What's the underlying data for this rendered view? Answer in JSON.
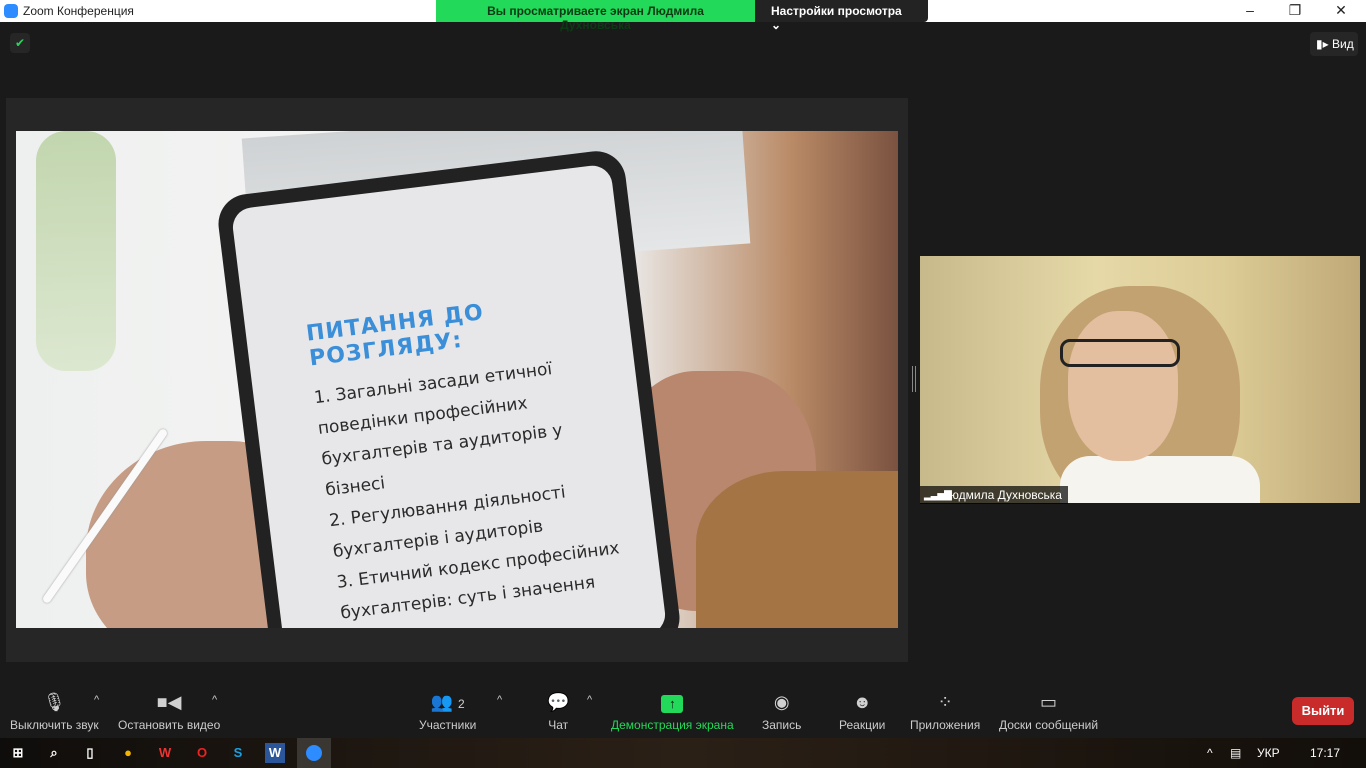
{
  "window": {
    "title": "Zoom Конференция"
  },
  "banner": {
    "viewing": "Вы просматриваете экран Людмила Духновська",
    "settings": "Настройки просмотра ⌄"
  },
  "top": {
    "view_label": "Вид"
  },
  "slide": {
    "heading": "ПИТАННЯ ДО РОЗГЛЯДУ:",
    "items": [
      "1. Загальні засади етичної поведінки професійних бухгалтерів та аудиторів  у бізнесі",
      "2. Регулювання діяльності бухгалтерів і аудиторів",
      "3. Етичний кодекс професійних бухгалтерів: суть і значення"
    ]
  },
  "video": {
    "participant_name": "Людмила Духновська"
  },
  "toolbar": {
    "mute": "Выключить звук",
    "video": "Остановить видео",
    "participants": "Участники",
    "participants_count": "2",
    "chat": "Чат",
    "share": "Демонстрация экрана",
    "record": "Запись",
    "reactions": "Реакции",
    "apps": "Приложения",
    "whiteboards": "Доски сообщений",
    "leave": "Выйти"
  },
  "taskbar": {
    "lang": "УКР",
    "time": "17:17"
  },
  "colors": {
    "accent_green": "#23d959",
    "leave_red": "#c92a2a",
    "heading_blue": "#3b8ed8"
  }
}
